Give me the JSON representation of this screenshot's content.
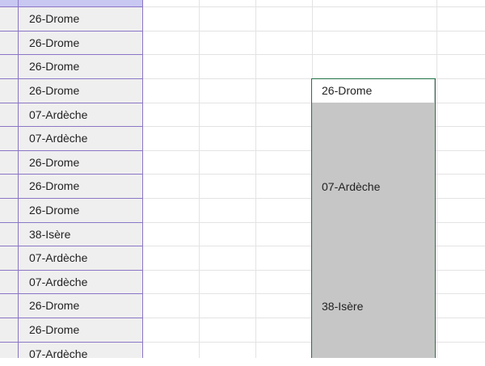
{
  "left_column": {
    "cells": [
      "26-Drome",
      "26-Drome",
      "26-Drome",
      "26-Drome",
      "07-Ardèche",
      "07-Ardèche",
      "26-Drome",
      "26-Drome",
      "26-Drome",
      "38-Isère",
      "07-Ardèche",
      "07-Ardèche",
      "26-Drome",
      "26-Drome",
      "07-Ardèche"
    ]
  },
  "selection": {
    "active_value": "26-Drome",
    "labels": [
      "07-Ardèche",
      "38-Isère"
    ]
  },
  "colors": {
    "selection_border": "#217346",
    "selection_fill": "#c6c6c6",
    "column_border": "#8a76c6"
  }
}
